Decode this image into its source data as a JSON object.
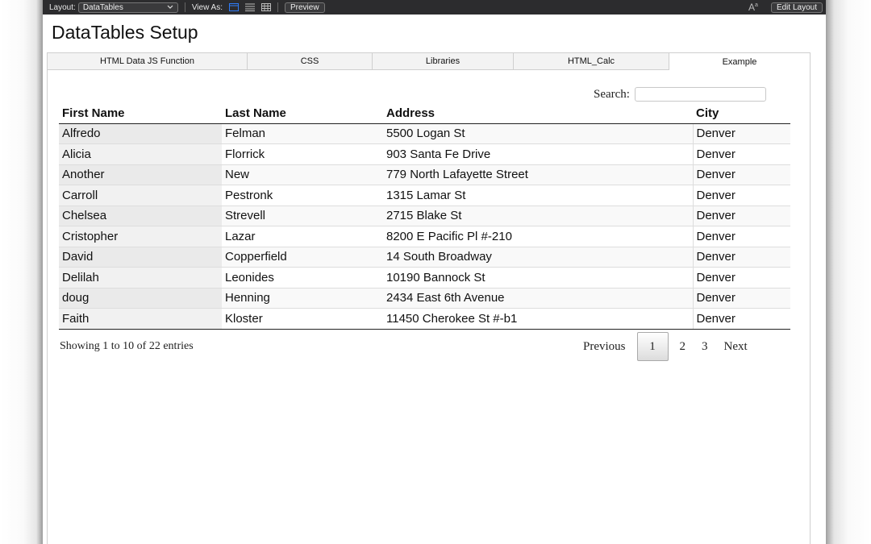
{
  "toolbar": {
    "layout_label": "Layout:",
    "layout_value": "DataTables",
    "view_as_label": "View As:",
    "view_icons": [
      "form-view-icon",
      "list-view-icon",
      "table-view-icon"
    ],
    "preview_label": "Preview",
    "font_size_glyph": "A",
    "edit_layout_label": "Edit Layout"
  },
  "page": {
    "title": "DataTables Setup"
  },
  "tabs": [
    {
      "label": "HTML Data JS Function",
      "active": false
    },
    {
      "label": "CSS",
      "active": false
    },
    {
      "label": "Libraries",
      "active": false
    },
    {
      "label": "HTML_Calc",
      "active": false
    },
    {
      "label": "Example",
      "active": true
    }
  ],
  "search": {
    "label": "Search:",
    "value": ""
  },
  "table": {
    "columns": [
      "First Name",
      "Last Name",
      "Address",
      "City"
    ],
    "rows": [
      [
        "Alfredo",
        "Felman",
        "5500 Logan St",
        "Denver"
      ],
      [
        "Alicia",
        "Florrick",
        "903 Santa Fe Drive",
        "Denver"
      ],
      [
        "Another",
        "New",
        "779 North Lafayette Street",
        "Denver"
      ],
      [
        "Carroll",
        "Pestronk",
        "1315 Lamar St",
        "Denver"
      ],
      [
        "Chelsea",
        "Strevell",
        "2715 Blake St",
        "Denver"
      ],
      [
        "Cristopher",
        "Lazar",
        "8200 E Pacific Pl #-210",
        "Denver"
      ],
      [
        "David",
        "Copperfield",
        "14 South Broadway",
        "Denver"
      ],
      [
        "Delilah",
        "Leonides",
        "10190 Bannock St",
        "Denver"
      ],
      [
        "doug",
        "Henning",
        "2434 East 6th Avenue",
        "Denver"
      ],
      [
        "Faith",
        "Kloster",
        "11450 Cherokee St #-b1",
        "Denver"
      ]
    ],
    "info": "Showing 1 to 10 of 22 entries"
  },
  "pagination": {
    "previous": "Previous",
    "pages": [
      "1",
      "2",
      "3"
    ],
    "current": "1",
    "next": "Next"
  },
  "colors": {
    "toolbar_bg": "#2c2c2e",
    "active_view_icon": "#2f7bf5"
  }
}
